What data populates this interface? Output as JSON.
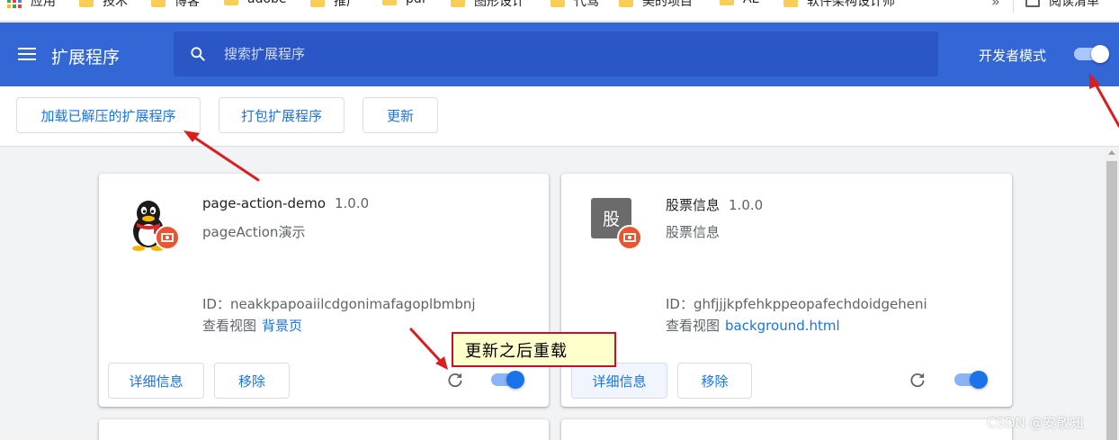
{
  "bookmarks": {
    "apps_label": "应用",
    "items": [
      "技术",
      "博客",
      "adobe",
      "推广",
      "pdf",
      "图形设计",
      "代驾",
      "美的项目",
      "AE",
      "软件架构设计师"
    ],
    "overflow": "»",
    "reading_list": "阅读清单"
  },
  "header": {
    "title": "扩展程序",
    "search_placeholder": "搜索扩展程序",
    "dev_mode_label": "开发者模式",
    "dev_mode_on": true
  },
  "actions": {
    "load_unpacked": "加载已解压的扩展程序",
    "pack": "打包扩展程序",
    "update": "更新"
  },
  "extensions": [
    {
      "name": "page-action-demo",
      "version": "1.0.0",
      "description": "pageAction演示",
      "id_label": "ID：",
      "id": "neakkpapoaiilcdgonimafagoplbmbnj",
      "views_label": "查看视图",
      "view_link": "背景页",
      "details_label": "详细信息",
      "remove_label": "移除",
      "enabled": true
    },
    {
      "name": "股票信息",
      "version": "1.0.0",
      "description": "股票信息",
      "icon_text": "股",
      "id_label": "ID：",
      "id": "ghfjjjkpfehkppeopafechdoidgeheni",
      "views_label": "查看视图",
      "view_link": "background.html",
      "details_label": "详细信息",
      "remove_label": "移除",
      "enabled": true
    }
  ],
  "annotation": "更新之后重载",
  "watermark": "CSDN @安敬知",
  "colors": {
    "toolbar": "#3367d6",
    "search": "#2a56c6",
    "accent": "#1a73e8",
    "annotation_border": "#c8102e",
    "annotation_fill": "#ffffcc",
    "badge": "#e8552f"
  }
}
